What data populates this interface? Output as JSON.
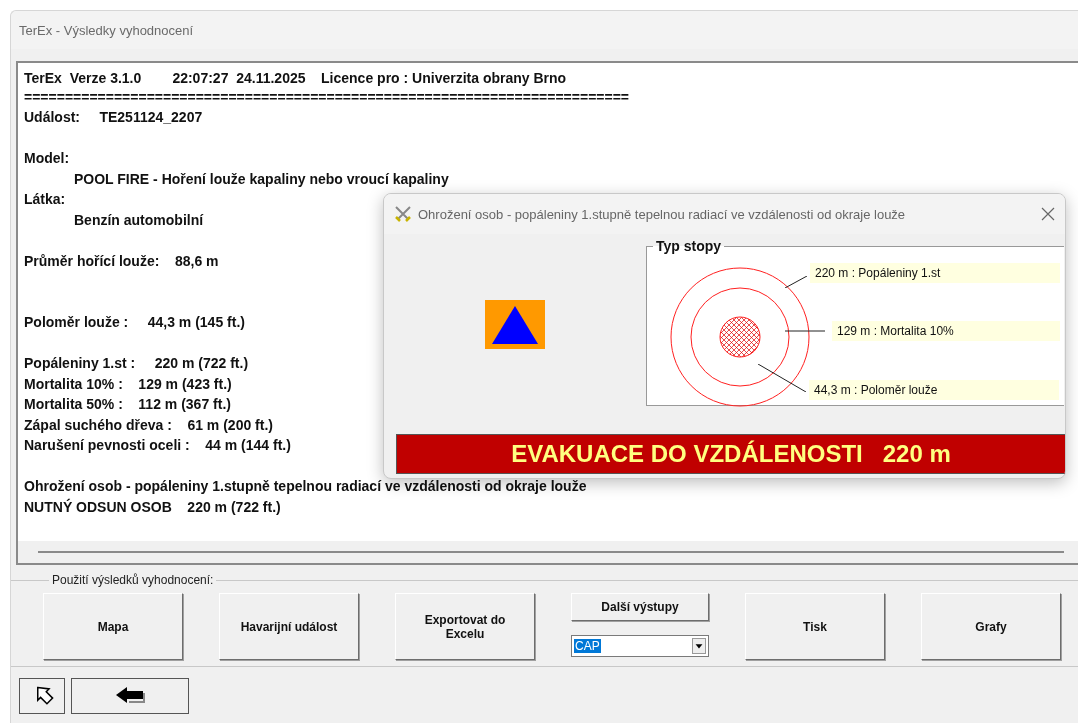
{
  "window": {
    "title": "TerEx - Výsledky vyhodnocení"
  },
  "report": {
    "header": "TerEx  Verze 3.1.0        22:07:27  24.11.2025    Licence pro : Univerzita obrany Brno",
    "separator": "==========================================================================",
    "lines": [
      {
        "kind": "text",
        "text": "Událost:     TE251124_2207"
      },
      {
        "kind": "blank"
      },
      {
        "kind": "text",
        "text": "Model:"
      },
      {
        "kind": "indent",
        "text": "POOL FIRE - Hoření louže kapaliny nebo vroucí kapaliny"
      },
      {
        "kind": "text",
        "text": "Látka:"
      },
      {
        "kind": "indent",
        "text": "Benzín automobilní"
      },
      {
        "kind": "blank"
      },
      {
        "kind": "text",
        "text": "Průměr hořící louže:    88,6 m"
      },
      {
        "kind": "blank"
      },
      {
        "kind": "blank"
      },
      {
        "kind": "text",
        "text": "Poloměr louže :     44,3 m (145 ft.)"
      },
      {
        "kind": "blank"
      },
      {
        "kind": "text",
        "text": "Popáleniny 1.st :     220 m (722 ft.)"
      },
      {
        "kind": "text",
        "text": "Mortalita 10% :    129 m (423 ft.)"
      },
      {
        "kind": "text",
        "text": "Mortalita 50% :    112 m (367 ft.)"
      },
      {
        "kind": "text",
        "text": "Zápal suchého dřeva :    61 m (200 ft.)"
      },
      {
        "kind": "text",
        "text": "Narušení pevnosti oceli :    44 m (144 ft.)"
      },
      {
        "kind": "blank"
      },
      {
        "kind": "text",
        "text": "Ohrožení osob - popáleniny 1.stupně tepelnou radiací ve vzdálenosti od okraje louže"
      },
      {
        "kind": "text",
        "text": "NUTNÝ ODSUN OSOB    220 m (722 ft.)"
      }
    ]
  },
  "dialog": {
    "title": "Ohrožení osob - popáleniny 1.stupně tepelnou radiací ve vzdálenosti od okraje louže",
    "diagram": {
      "title": "Typ stopy",
      "labels": [
        "220 m : Popáleniny 1.st",
        "129 m : Mortalita 10%",
        "44,3 m : Poloměr louže"
      ]
    },
    "banner": "EVAKUACE DO VZDÁLENOSTI   220 m"
  },
  "actions": {
    "label": "Použití výsledků vyhodnocení:",
    "buttons": [
      {
        "kind": "button",
        "label": "Mapa"
      },
      {
        "kind": "button",
        "label": "Havarijní událost"
      },
      {
        "kind": "button",
        "label": "Exportovat do Excelu"
      },
      {
        "kind": "output",
        "label": "Další výstupy",
        "value": "CAP"
      },
      {
        "kind": "button",
        "label": "Tisk"
      },
      {
        "kind": "button",
        "label": "Grafy"
      }
    ]
  }
}
